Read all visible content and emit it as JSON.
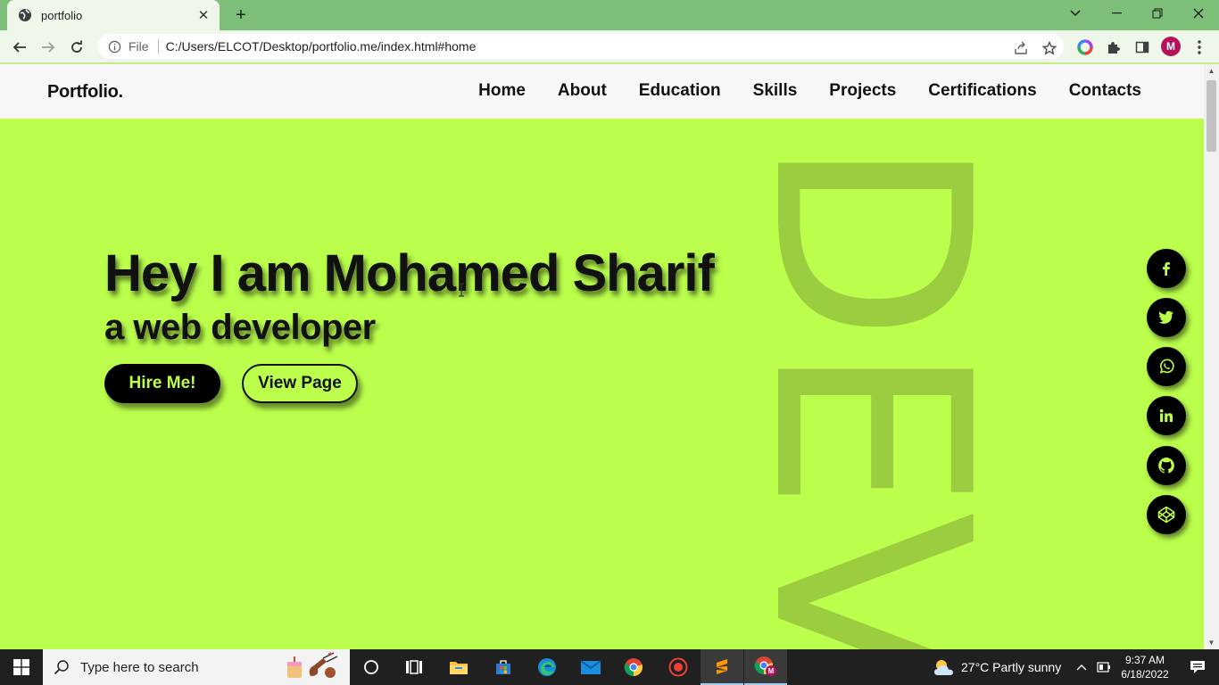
{
  "browser": {
    "tab_title": "portfolio",
    "url_scheme": "File",
    "url": "C:/Users/ELCOT/Desktop/portfolio.me/index.html#home",
    "profile_initial": "M"
  },
  "site": {
    "logo": "Portfolio.",
    "nav": [
      "Home",
      "About",
      "Education",
      "Skills",
      "Projects",
      "Certifications",
      "Contacts"
    ]
  },
  "hero": {
    "title": "Hey I am Mohamed Sharif",
    "subtitle": "a web developer",
    "hire_label": "Hire Me!",
    "view_label": "View Page",
    "background_word": "DEV",
    "accent_color": "#bbff4c",
    "background_word_color": "#9ccc3f"
  },
  "social": [
    "facebook-icon",
    "twitter-icon",
    "whatsapp-icon",
    "linkedin-icon",
    "github-icon",
    "codepen-icon"
  ],
  "taskbar": {
    "search_placeholder": "Type here to search",
    "weather": "27°C  Partly sunny",
    "time": "9:37 AM",
    "date": "6/18/2022"
  }
}
